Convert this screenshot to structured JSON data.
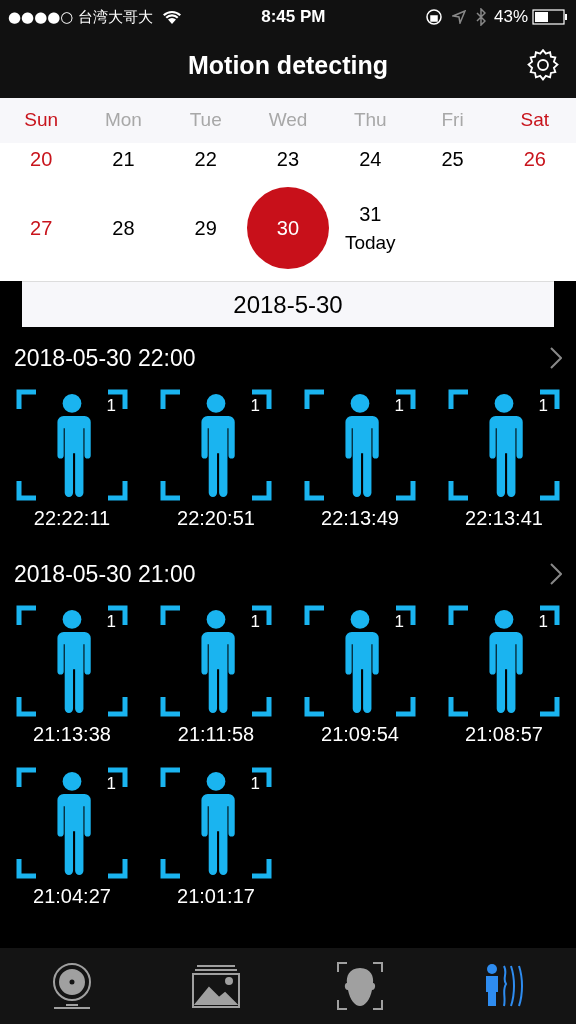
{
  "status_bar": {
    "carrier": "●●●●○ 台湾大哥大",
    "time": "8:45 PM",
    "battery": "43%"
  },
  "header": {
    "title": "Motion detecting"
  },
  "calendar": {
    "weekdays": [
      {
        "label": "Sun",
        "weekend": true
      },
      {
        "label": "Mon",
        "weekend": false
      },
      {
        "label": "Tue",
        "weekend": false
      },
      {
        "label": "Wed",
        "weekend": false
      },
      {
        "label": "Thu",
        "weekend": false
      },
      {
        "label": "Fri",
        "weekend": false
      },
      {
        "label": "Sat",
        "weekend": true
      }
    ],
    "weeks": [
      [
        {
          "day": "20",
          "weekend": true,
          "selected": false
        },
        {
          "day": "21",
          "weekend": false,
          "selected": false
        },
        {
          "day": "22",
          "weekend": false,
          "selected": false
        },
        {
          "day": "23",
          "weekend": false,
          "selected": false
        },
        {
          "day": "24",
          "weekend": false,
          "selected": false
        },
        {
          "day": "25",
          "weekend": false,
          "selected": false
        },
        {
          "day": "26",
          "weekend": true,
          "selected": false
        }
      ],
      [
        {
          "day": "27",
          "weekend": true,
          "selected": false
        },
        {
          "day": "28",
          "weekend": false,
          "selected": false
        },
        {
          "day": "29",
          "weekend": false,
          "selected": false
        },
        {
          "day": "30",
          "weekend": false,
          "selected": true
        },
        {
          "day": "31",
          "weekend": false,
          "selected": false,
          "note": "Today"
        }
      ]
    ],
    "selected_date": "2018-5-30"
  },
  "groups": [
    {
      "title": "2018-05-30 22:00",
      "events": [
        {
          "count": "1",
          "time": "22:22:11"
        },
        {
          "count": "1",
          "time": "22:20:51"
        },
        {
          "count": "1",
          "time": "22:13:49"
        },
        {
          "count": "1",
          "time": "22:13:41"
        }
      ]
    },
    {
      "title": "2018-05-30 21:00",
      "events": [
        {
          "count": "1",
          "time": "21:13:38"
        },
        {
          "count": "1",
          "time": "21:11:58"
        },
        {
          "count": "1",
          "time": "21:09:54"
        },
        {
          "count": "1",
          "time": "21:08:57"
        },
        {
          "count": "1",
          "time": "21:04:27"
        },
        {
          "count": "1",
          "time": "21:01:17"
        }
      ]
    }
  ],
  "tab_bar": [
    {
      "kind": "camera",
      "selected": false
    },
    {
      "kind": "gallery",
      "selected": false
    },
    {
      "kind": "face",
      "selected": false
    },
    {
      "kind": "motion",
      "selected": true
    }
  ]
}
